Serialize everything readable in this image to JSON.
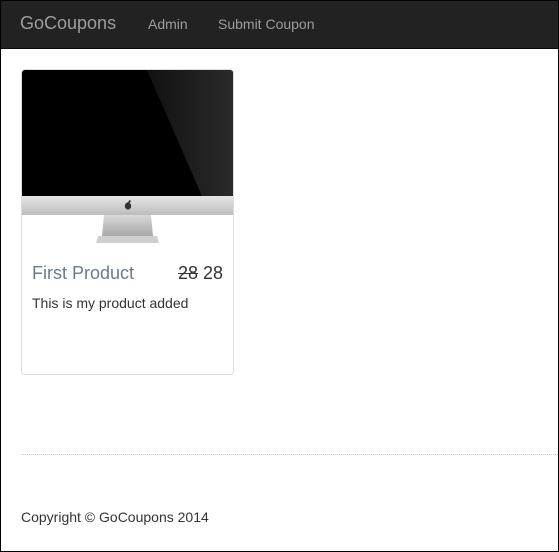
{
  "navbar": {
    "brand": "GoCoupons",
    "links": [
      {
        "label": "Admin"
      },
      {
        "label": "Submit Coupon"
      }
    ]
  },
  "products": [
    {
      "name": "First Product",
      "old_price": "28",
      "price": "28",
      "description": "This is my product added",
      "image_icon": "imac-image"
    }
  ],
  "footer": {
    "copyright": "Copyright © GoCoupons 2014"
  }
}
